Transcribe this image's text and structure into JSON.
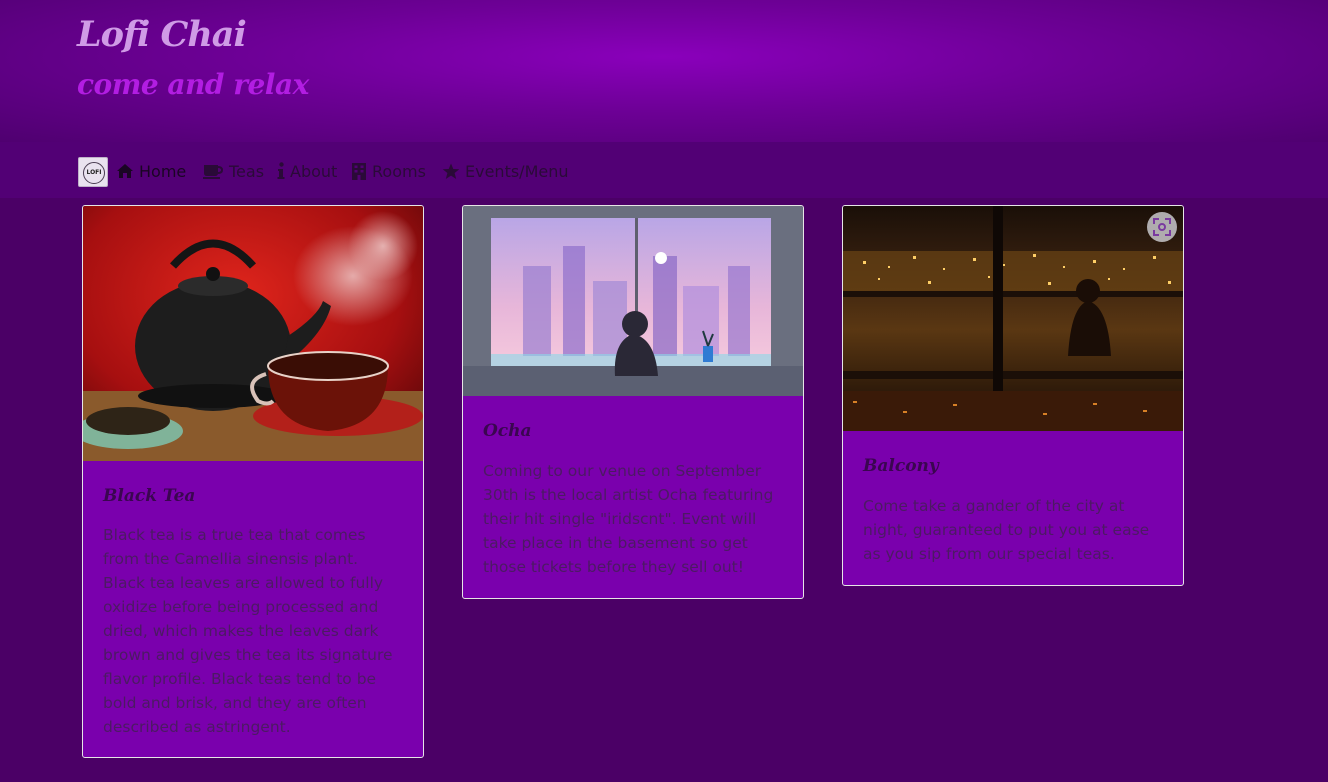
{
  "header": {
    "title": "Lofi Chai",
    "subtitle": "come and relax"
  },
  "nav": {
    "logo_text": "LOFI",
    "items": [
      {
        "label": "Home",
        "icon": "home-icon"
      },
      {
        "label": "Teas",
        "icon": "coffee-cup-icon"
      },
      {
        "label": "About",
        "icon": "info-icon"
      },
      {
        "label": "Rooms",
        "icon": "building-icon"
      },
      {
        "label": "Events/Menu",
        "icon": "star-icon"
      }
    ]
  },
  "cards": [
    {
      "title": "Black Tea",
      "text": "Black tea is a true tea that comes from the Camellia sinensis plant. Black tea leaves are allowed to fully oxidize before being processed and dried, which makes the leaves dark brown and gives the tea its signature flavor profile. Black teas tend to be bold and brisk, and they are often described as astringent.",
      "image": "teapot-and-cup-photo"
    },
    {
      "title": "Ocha",
      "text": "Coming to our venue on September 30th is the local artist Ocha featuring their hit single \"iridscnt\". Event will take place in the basement so get those tickets before they sell out!",
      "image": "lofi-girl-window-city-illustration"
    },
    {
      "title": "Balcony",
      "text": "Come take a gander of the city at night, guaranteed to put you at ease as you sip from our special teas.",
      "image": "night-city-balcony-photo"
    }
  ],
  "colors": {
    "background": "#4b0066",
    "header_bg": "#7a00a8",
    "card_bg": "#7a00ad",
    "title_color": "#cf9be6",
    "subtitle_color": "#b21de2"
  }
}
